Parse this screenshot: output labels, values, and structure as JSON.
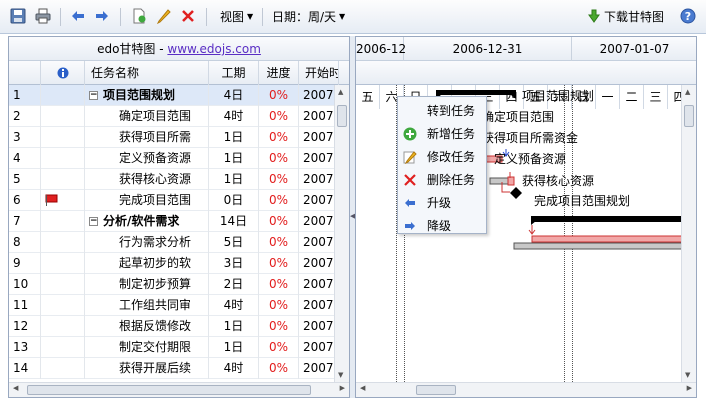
{
  "toolbar": {
    "view_label": "视图",
    "date_label": "日期：周/天",
    "download_label": "下载甘特图"
  },
  "grid": {
    "site_prefix": "edo甘特图 - ",
    "site_link": "www.edojs.com",
    "columns": [
      "",
      "",
      "任务名称",
      "工期",
      "进度",
      "开始时"
    ],
    "rows": [
      {
        "id": "1",
        "name": "项目范围规划",
        "duration": "4日",
        "progress": "0%",
        "start": "2007-",
        "summary": true,
        "selected": true,
        "flag": false
      },
      {
        "id": "2",
        "name": "确定项目范围",
        "duration": "4时",
        "progress": "0%",
        "start": "2007-",
        "summary": false,
        "selected": false,
        "flag": false
      },
      {
        "id": "3",
        "name": "获得项目所需",
        "duration": "1日",
        "progress": "0%",
        "start": "2007-",
        "summary": false,
        "selected": false,
        "flag": false
      },
      {
        "id": "4",
        "name": "定义预备资源",
        "duration": "1日",
        "progress": "0%",
        "start": "2007-",
        "summary": false,
        "selected": false,
        "flag": false
      },
      {
        "id": "5",
        "name": "获得核心资源",
        "duration": "1日",
        "progress": "0%",
        "start": "2007-",
        "summary": false,
        "selected": false,
        "flag": false
      },
      {
        "id": "6",
        "name": "完成项目范围",
        "duration": "0日",
        "progress": "0%",
        "start": "2007-",
        "summary": false,
        "selected": false,
        "flag": true
      },
      {
        "id": "7",
        "name": "分析/软件需求",
        "duration": "14日",
        "progress": "0%",
        "start": "2007-",
        "summary": true,
        "selected": false,
        "flag": false
      },
      {
        "id": "8",
        "name": "行为需求分析",
        "duration": "5日",
        "progress": "0%",
        "start": "2007-",
        "summary": false,
        "selected": false,
        "flag": false
      },
      {
        "id": "9",
        "name": "起草初步的软",
        "duration": "3日",
        "progress": "0%",
        "start": "2007-",
        "summary": false,
        "selected": false,
        "flag": false
      },
      {
        "id": "10",
        "name": "制定初步预算",
        "duration": "2日",
        "progress": "0%",
        "start": "2007-",
        "summary": false,
        "selected": false,
        "flag": false
      },
      {
        "id": "11",
        "name": "工作组共同审",
        "duration": "4时",
        "progress": "0%",
        "start": "2007-",
        "summary": false,
        "selected": false,
        "flag": false
      },
      {
        "id": "12",
        "name": "根据反馈修改",
        "duration": "1日",
        "progress": "0%",
        "start": "2007-",
        "summary": false,
        "selected": false,
        "flag": false
      },
      {
        "id": "13",
        "name": "制定交付期限",
        "duration": "1日",
        "progress": "0%",
        "start": "2007-",
        "summary": false,
        "selected": false,
        "flag": false
      },
      {
        "id": "14",
        "name": "获得开展后续",
        "duration": "4时",
        "progress": "0%",
        "start": "2007-",
        "summary": false,
        "selected": false,
        "flag": false
      }
    ]
  },
  "gantt": {
    "dates": [
      "2006-12",
      "2006-12-31",
      "2007-01-07"
    ],
    "days": [
      "五",
      "六",
      "日",
      "一",
      "二",
      "三",
      "四",
      "五",
      "六",
      "日",
      "一",
      "二",
      "三",
      "四"
    ],
    "labels": [
      "项目范围规划",
      "确定项目范围",
      "获得项目所需资金",
      "定义预备资源",
      "获得核心资源",
      "完成项目范围规划"
    ]
  },
  "context_menu": {
    "items": [
      {
        "label": "转到任务",
        "icon": "none"
      },
      {
        "label": "新增任务",
        "icon": "add-icon"
      },
      {
        "label": "修改任务",
        "icon": "edit-icon"
      },
      {
        "label": "删除任务",
        "icon": "delete-icon"
      },
      {
        "label": "升级",
        "icon": "arrow-left-icon"
      },
      {
        "label": "降级",
        "icon": "arrow-right-icon"
      }
    ]
  },
  "colors": {
    "progress": "#e21c1c",
    "summary_bar": "#000000",
    "task_bar_fill": "#f1a7a7",
    "task_bar_border": "#cc3333",
    "selection": "#dde8f8",
    "link": "#5a2ec4"
  }
}
